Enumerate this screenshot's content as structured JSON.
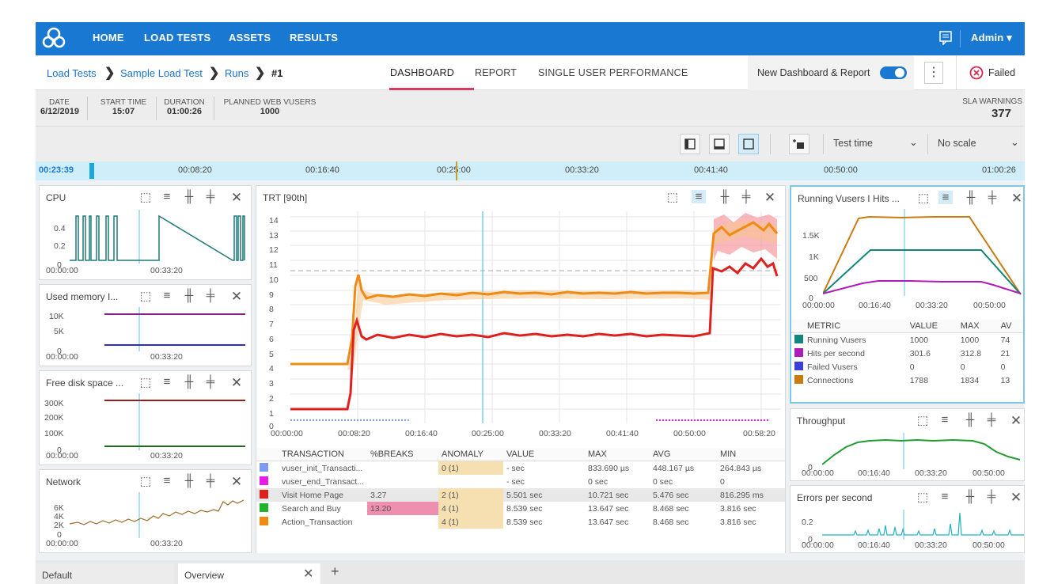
{
  "nav": {
    "home": "HOME",
    "load_tests": "LOAD TESTS",
    "assets": "ASSETS",
    "results": "RESULTS",
    "user": "Admin ▾"
  },
  "breadcrumb": {
    "c1": "Load Tests",
    "c2": "Sample Load Test",
    "c3": "Runs",
    "c4": "#1",
    "sep": "❯"
  },
  "tabs": {
    "dashboard": "DASHBOARD",
    "report": "REPORT",
    "single": "SINGLE USER PERFORMANCE"
  },
  "toggle": {
    "label": "New Dashboard & Report",
    "on": true
  },
  "status": {
    "label": "Failed"
  },
  "summary": {
    "date_l": "DATE",
    "date_v": "6/12/2019",
    "start_l": "START TIME",
    "start_v": "15:07",
    "dur_l": "DURATION",
    "dur_v": "01:00:26",
    "vu_l": "PLANNED WEB VUSERS",
    "vu_v": "1000",
    "sla_l": "SLA WARNINGS",
    "sla_v": "377"
  },
  "toolbar": {
    "time_mode": "Test time",
    "scale": "No scale"
  },
  "timeline": {
    "current": "00:23:39",
    "ticks": [
      "00:08:20",
      "00:16:40",
      "00:25:00",
      "00:33:20",
      "00:41:40",
      "00:50:00",
      "01:00:26"
    ],
    "progress": 0.39
  },
  "cpu": {
    "title": "CPU",
    "y": [
      "0.4",
      "0.2",
      "0"
    ],
    "x": [
      "00:00:00",
      "00:33:20"
    ]
  },
  "memory": {
    "title": "Used memory I...",
    "y": [
      "10K",
      "5K",
      "0"
    ],
    "x": [
      "00:00:00",
      "00:33:20"
    ]
  },
  "disk": {
    "title": "Free disk space ...",
    "y": [
      "300K",
      "200K",
      "100K",
      "0"
    ],
    "x": [
      "00:00:00",
      "00:33:20"
    ]
  },
  "network": {
    "title": "Network",
    "y": [
      "6K",
      "4K",
      "2K",
      "0"
    ],
    "x": [
      "00:00:00",
      "00:33:20"
    ]
  },
  "trt": {
    "title": "TRT [90th]",
    "y": [
      "14",
      "13",
      "12",
      "11",
      "10",
      "9",
      "8",
      "7",
      "6",
      "5",
      "4",
      "3",
      "2",
      "1",
      "0"
    ],
    "x": [
      "00:00:00",
      "00:08:20",
      "00:16:40",
      "00:25:00",
      "00:33:20",
      "00:41:40",
      "00:50:00",
      "00:58:20"
    ]
  },
  "trt_table": {
    "headers": [
      "TRANSACTION",
      "%BREAKS",
      "ANOMALY",
      "VALUE",
      "MAX",
      "AVG",
      "MIN"
    ],
    "rows": [
      {
        "color": "#7b9cf2",
        "name": "vuser_init_Transacti...",
        "breaks": "",
        "anomaly": "0 (1)",
        "value": "- sec",
        "max": "833.690 µs",
        "avg": "448.167 µs",
        "min": "264.843 µs"
      },
      {
        "color": "#e81be8",
        "name": "vuser_end_Transact...",
        "breaks": "",
        "anomaly": "",
        "value": "- sec",
        "max": "0 sec",
        "avg": "0 sec",
        "min": "0"
      },
      {
        "color": "#e01f1f",
        "name": "Visit Home Page",
        "breaks": "3.27",
        "anomaly": "2 (1)",
        "value": "5.501 sec",
        "max": "10.721 sec",
        "avg": "5.476 sec",
        "min": "816.295 ms"
      },
      {
        "color": "#22b22b",
        "name": "Search and Buy",
        "breaks": "13.20",
        "anomaly": "4 (1)",
        "value": "8.539 sec",
        "max": "13.647 sec",
        "avg": "8.468 sec",
        "min": "3.816 sec"
      },
      {
        "color": "#ef8a12",
        "name": "Action_Transaction",
        "breaks": "",
        "anomaly": "4 (1)",
        "value": "8.539 sec",
        "max": "13.647 sec",
        "avg": "8.468 sec",
        "min": "3.816 sec"
      }
    ]
  },
  "running": {
    "title": "Running Vusers I Hits ...",
    "y": [
      "1.5K",
      "1K",
      "500",
      "0"
    ],
    "x": [
      "00:00:00",
      "00:16:40",
      "00:33:20",
      "00:50:00"
    ]
  },
  "running_table": {
    "headers": [
      "METRIC",
      "VALUE",
      "MAX",
      "AV"
    ],
    "rows": [
      {
        "color": "#12857d",
        "name": "Running Vusers",
        "value": "1000",
        "max": "1000",
        "avg": "74"
      },
      {
        "color": "#b01ab8",
        "name": "Hits per second",
        "value": "301.6",
        "max": "312.8",
        "avg": "21"
      },
      {
        "color": "#3b3fd8",
        "name": "Failed Vusers",
        "value": "0",
        "max": "0",
        "avg": "0"
      },
      {
        "color": "#c97a11",
        "name": "Connections",
        "value": "1788",
        "max": "1834",
        "avg": "13"
      }
    ]
  },
  "throughput": {
    "title": "Throughput",
    "y": [
      "0"
    ],
    "x": [
      "00:00:00",
      "00:16:40",
      "00:33:20",
      "00:50:00"
    ]
  },
  "errors": {
    "title": "Errors per second",
    "y": [
      "0.2",
      "0"
    ],
    "x": [
      "00:00:00",
      "00:16:40",
      "00:33:20",
      "00:50:00"
    ]
  },
  "bottom": {
    "t1": "Default",
    "t2": "Overview"
  }
}
